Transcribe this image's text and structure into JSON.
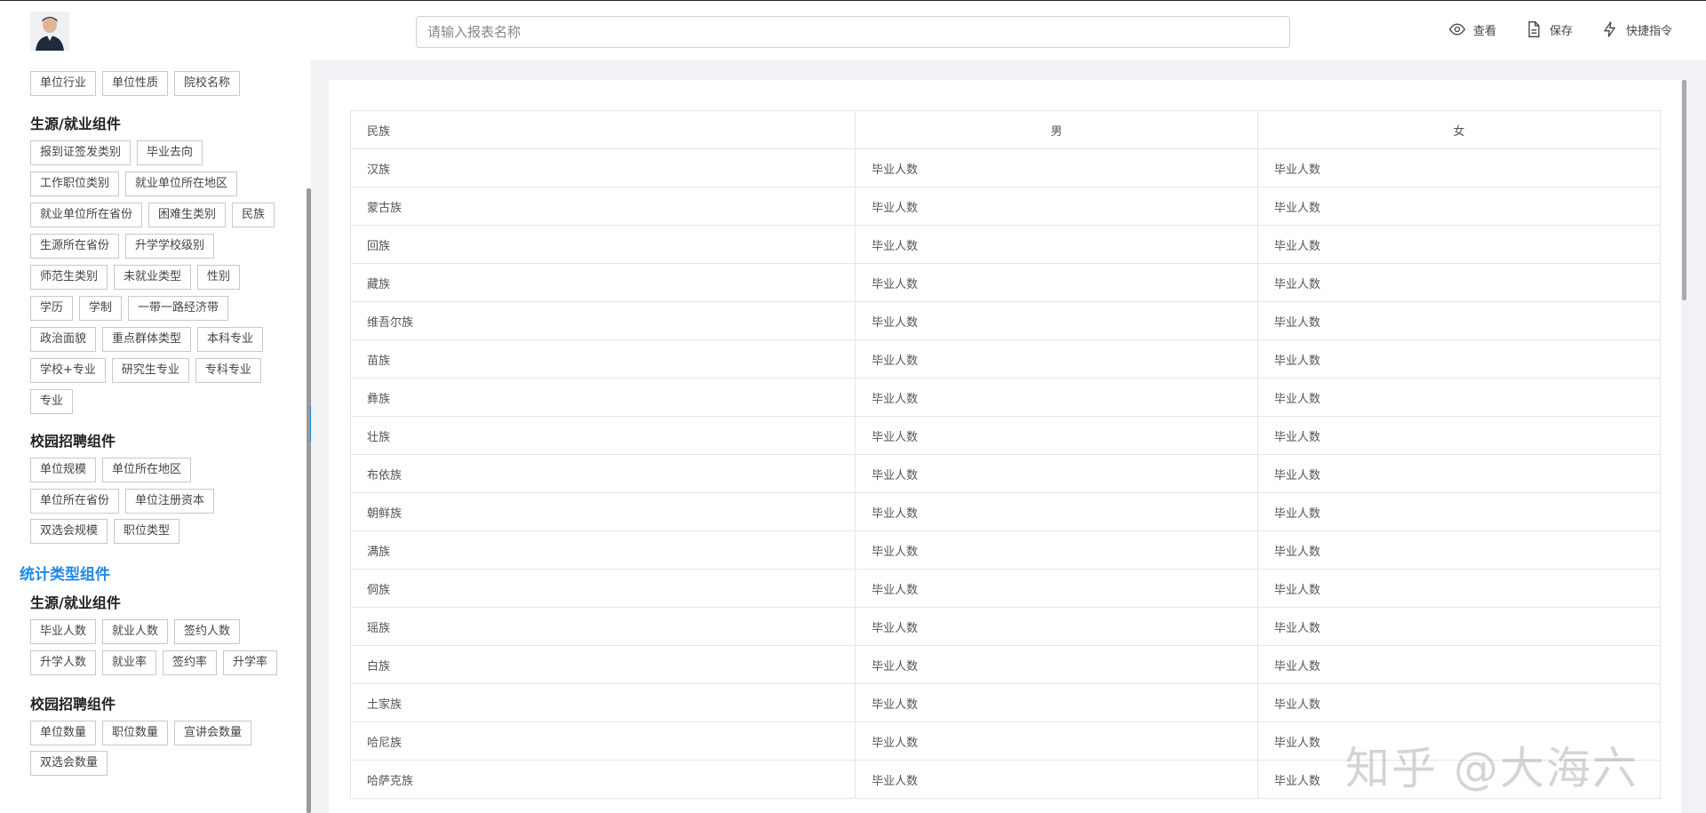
{
  "search": {
    "placeholder": "请输入报表名称",
    "value": ""
  },
  "actions": [
    {
      "icon": "eye-icon",
      "label": "查看"
    },
    {
      "icon": "document-icon",
      "label": "保存"
    },
    {
      "icon": "lightning-icon",
      "label": "快捷指令"
    }
  ],
  "sidebar": {
    "top_chips": [
      "单位行业",
      "单位性质",
      "院校名称"
    ],
    "section1": {
      "title": "生源/就业组件",
      "rows": [
        [
          "报到证签发类别",
          "毕业去向"
        ],
        [
          "工作职位类别",
          "就业单位所在地区"
        ],
        [
          "就业单位所在省份",
          "困难生类别",
          "民族"
        ],
        [
          "生源所在省份",
          "升学学校级别"
        ],
        [
          "师范生类别",
          "未就业类型",
          "性别"
        ],
        [
          "学历",
          "学制",
          "一带一路经济带"
        ],
        [
          "政治面貌",
          "重点群体类型",
          "本科专业"
        ],
        [
          "学校+专业",
          "研究生专业",
          "专科专业"
        ],
        [
          "专业"
        ]
      ]
    },
    "section2": {
      "title": "校园招聘组件",
      "rows": [
        [
          "单位规模",
          "单位所在地区"
        ],
        [
          "单位所在省份",
          "单位注册资本"
        ],
        [
          "双选会规模",
          "职位类型"
        ]
      ]
    },
    "stat_title": "统计类型组件",
    "section3": {
      "title": "生源/就业组件",
      "rows": [
        [
          "毕业人数",
          "就业人数",
          "签约人数"
        ],
        [
          "升学人数",
          "就业率",
          "签约率",
          "升学率"
        ]
      ]
    },
    "section4": {
      "title": "校园招聘组件",
      "rows": [
        [
          "单位数量",
          "职位数量",
          "宣讲会数量"
        ],
        [
          "双选会数量"
        ]
      ]
    }
  },
  "table": {
    "headers": [
      "民族",
      "男",
      "女"
    ],
    "rows": [
      [
        "汉族",
        "毕业人数",
        "毕业人数"
      ],
      [
        "蒙古族",
        "毕业人数",
        "毕业人数"
      ],
      [
        "回族",
        "毕业人数",
        "毕业人数"
      ],
      [
        "藏族",
        "毕业人数",
        "毕业人数"
      ],
      [
        "维吾尔族",
        "毕业人数",
        "毕业人数"
      ],
      [
        "苗族",
        "毕业人数",
        "毕业人数"
      ],
      [
        "彝族",
        "毕业人数",
        "毕业人数"
      ],
      [
        "壮族",
        "毕业人数",
        "毕业人数"
      ],
      [
        "布依族",
        "毕业人数",
        "毕业人数"
      ],
      [
        "朝鲜族",
        "毕业人数",
        "毕业人数"
      ],
      [
        "满族",
        "毕业人数",
        "毕业人数"
      ],
      [
        "侗族",
        "毕业人数",
        "毕业人数"
      ],
      [
        "瑶族",
        "毕业人数",
        "毕业人数"
      ],
      [
        "白族",
        "毕业人数",
        "毕业人数"
      ],
      [
        "土家族",
        "毕业人数",
        "毕业人数"
      ],
      [
        "哈尼族",
        "毕业人数",
        "毕业人数"
      ],
      [
        "哈萨克族",
        "毕业人数",
        "毕业人数"
      ]
    ]
  },
  "watermark": "知乎 @大海六"
}
